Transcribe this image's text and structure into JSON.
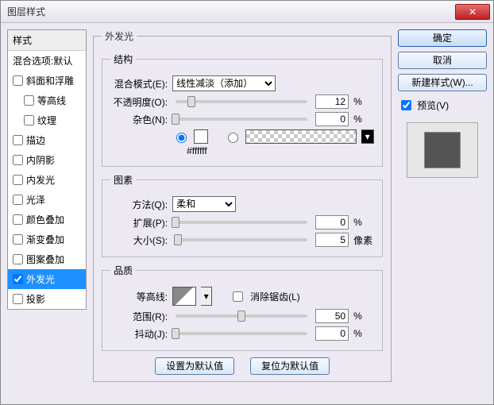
{
  "window": {
    "title": "图层样式"
  },
  "buttons": {
    "ok": "确定",
    "cancel": "取消",
    "new_style": "新建样式(W)...",
    "preview": "预览(V)",
    "make_default": "设置为默认值",
    "reset_default": "复位为默认值"
  },
  "styles": {
    "header": "样式",
    "blend_options": "混合选项:默认",
    "items": [
      {
        "label": "斜面和浮雕",
        "checked": false
      },
      {
        "label": "等高线",
        "checked": false,
        "sub": true
      },
      {
        "label": "纹理",
        "checked": false,
        "sub": true
      },
      {
        "label": "描边",
        "checked": false
      },
      {
        "label": "内阴影",
        "checked": false
      },
      {
        "label": "内发光",
        "checked": false
      },
      {
        "label": "光泽",
        "checked": false
      },
      {
        "label": "颜色叠加",
        "checked": false
      },
      {
        "label": "渐变叠加",
        "checked": false
      },
      {
        "label": "图案叠加",
        "checked": false
      },
      {
        "label": "外发光",
        "checked": true,
        "selected": true
      },
      {
        "label": "投影",
        "checked": false
      }
    ]
  },
  "outer_glow": {
    "title": "外发光",
    "structure": {
      "legend": "结构",
      "blend_mode_label": "混合模式(E):",
      "blend_mode_value": "线性减淡（添加）",
      "opacity_label": "不透明度(O):",
      "opacity_value": "12",
      "opacity_unit": "%",
      "noise_label": "杂色(N):",
      "noise_value": "0",
      "noise_unit": "%",
      "color_hex": "#ffffff"
    },
    "elements": {
      "legend": "图素",
      "technique_label": "方法(Q):",
      "technique_value": "柔和",
      "spread_label": "扩展(P):",
      "spread_value": "0",
      "spread_unit": "%",
      "size_label": "大小(S):",
      "size_value": "5",
      "size_unit": "像素"
    },
    "quality": {
      "legend": "品质",
      "contour_label": "等高线:",
      "anti_alias_label": "消除锯齿(L)",
      "range_label": "范围(R):",
      "range_value": "50",
      "range_unit": "%",
      "jitter_label": "抖动(J):",
      "jitter_value": "0",
      "jitter_unit": "%"
    }
  }
}
